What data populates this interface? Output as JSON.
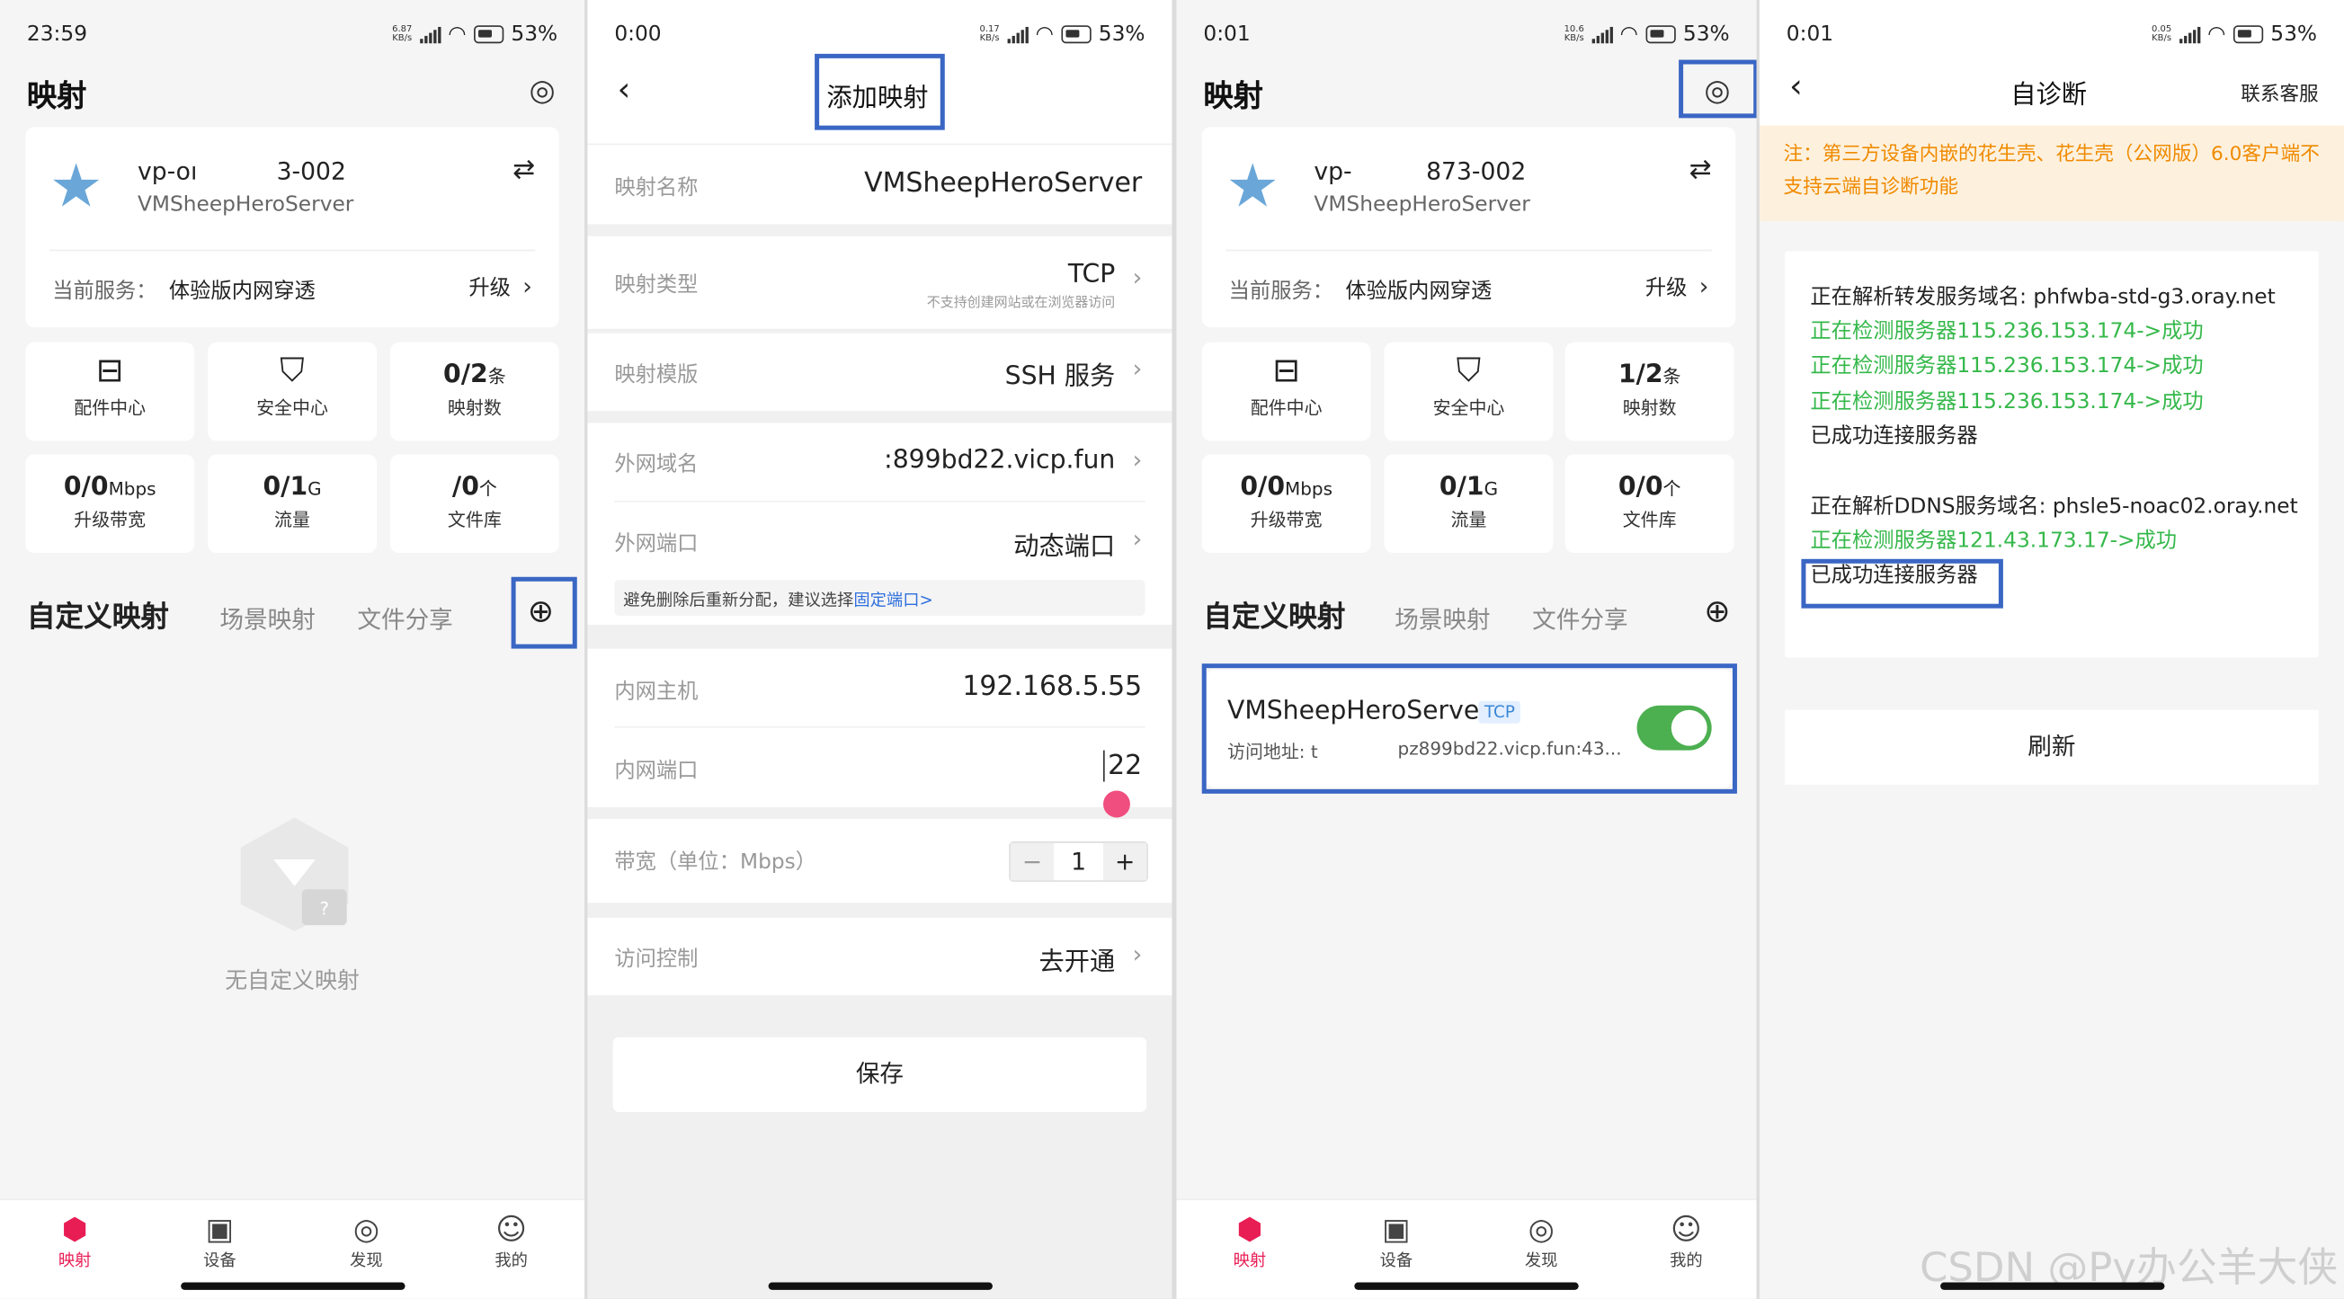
{
  "status": {
    "p1": {
      "time": "23:59",
      "net": "6.87\nKB/s",
      "battery": "53%"
    },
    "p2": {
      "time": "0:00",
      "net": "0.17\nKB/s",
      "battery": "53%"
    },
    "p3": {
      "time": "0:01",
      "net": "10.6\nKB/s",
      "battery": "53%"
    },
    "p4": {
      "time": "0:01",
      "net": "0.05\nKB/s",
      "battery": "53%"
    }
  },
  "mapping_home": {
    "title": "映射",
    "account_id_a": "vp-oı",
    "account_id_b": "3-002",
    "account_id_a_p3": "vp-",
    "account_id_b_p3": "873-002",
    "server_name": "VMSheepHeroServer",
    "service_label": "当前服务：",
    "service_value": "体验版内网穿透",
    "upgrade": "升级",
    "stats": {
      "accessory": "配件中心",
      "security": "安全中心",
      "map_count_p1": "0/2",
      "map_count_p3": "1/2",
      "map_count_unit": "条",
      "map_count_label": "映射数",
      "bandwidth": "0/0",
      "bandwidth_unit": "Mbps",
      "bandwidth_label": "升级带宽",
      "traffic": "0/1",
      "traffic_unit": "G",
      "traffic_label": "流量",
      "files_p1": "/0",
      "files_p3": "0/0",
      "files_unit": "个",
      "files_label": "文件库"
    },
    "tabs": [
      "自定义映射",
      "场景映射",
      "文件分享"
    ],
    "empty_text": "无自定义映射",
    "mapping_item": {
      "name": "VMSheepHeroServer",
      "protocol": "TCP",
      "addr_label": "访问地址: t",
      "addr_value": "pz899bd22.vicp.fun:43...",
      "enabled": true
    },
    "nav": [
      "映射",
      "设备",
      "发现",
      "我的"
    ]
  },
  "add_mapping": {
    "title": "添加映射",
    "fields": {
      "name_label": "映射名称",
      "name_value": "VMSheepHeroServer",
      "type_label": "映射类型",
      "type_value": "TCP",
      "type_note": "不支持创建网站或在浏览器访问",
      "template_label": "映射模版",
      "template_value": "SSH 服务",
      "domain_label": "外网域名",
      "domain_value": ":899bd22.vicp.fun",
      "port_label": "外网端口",
      "port_value": "动态端口",
      "notice": "避免删除后重新分配，建议选择",
      "notice_link": "固定端口>",
      "host_label": "内网主机",
      "host_value": "192.168.5.55",
      "inport_label": "内网端口",
      "inport_value": "22",
      "bw_label": "带宽（单位：Mbps）",
      "bw_value": "1",
      "acl_label": "访问控制",
      "acl_value": "去开通"
    },
    "save": "保存"
  },
  "diagnose": {
    "title": "自诊断",
    "contact": "联系客服",
    "warning": "注：第三方设备内嵌的花生壳、花生壳（公网版）6.0客户端不支持云端自诊断功能",
    "lines1": [
      {
        "text": "正在解析转发服务域名: phfwba-std-g3.oray.net",
        "ok": false
      },
      {
        "text": "正在检测服务器115.236.153.174->成功",
        "ok": true
      },
      {
        "text": "正在检测服务器115.236.153.174->成功",
        "ok": true
      },
      {
        "text": "正在检测服务器115.236.153.174->成功",
        "ok": true
      },
      {
        "text": "已成功连接服务器",
        "ok": false
      }
    ],
    "lines2": [
      {
        "text": "正在解析DDNS服务域名: phsle5-noac02.oray.net",
        "ok": false
      },
      {
        "text": "正在检测服务器121.43.173.17->成功",
        "ok": true
      },
      {
        "text": "已成功连接服务器",
        "ok": false
      }
    ],
    "refresh": "刷新",
    "watermark": "CSDN @Py办公羊大侠"
  },
  "colors": {
    "accent_blue": "#3a66c4",
    "success_green": "#35b84a",
    "brand_red": "#e81d54",
    "warn_bg": "#fdf1de",
    "warn_text": "#f08a00"
  }
}
